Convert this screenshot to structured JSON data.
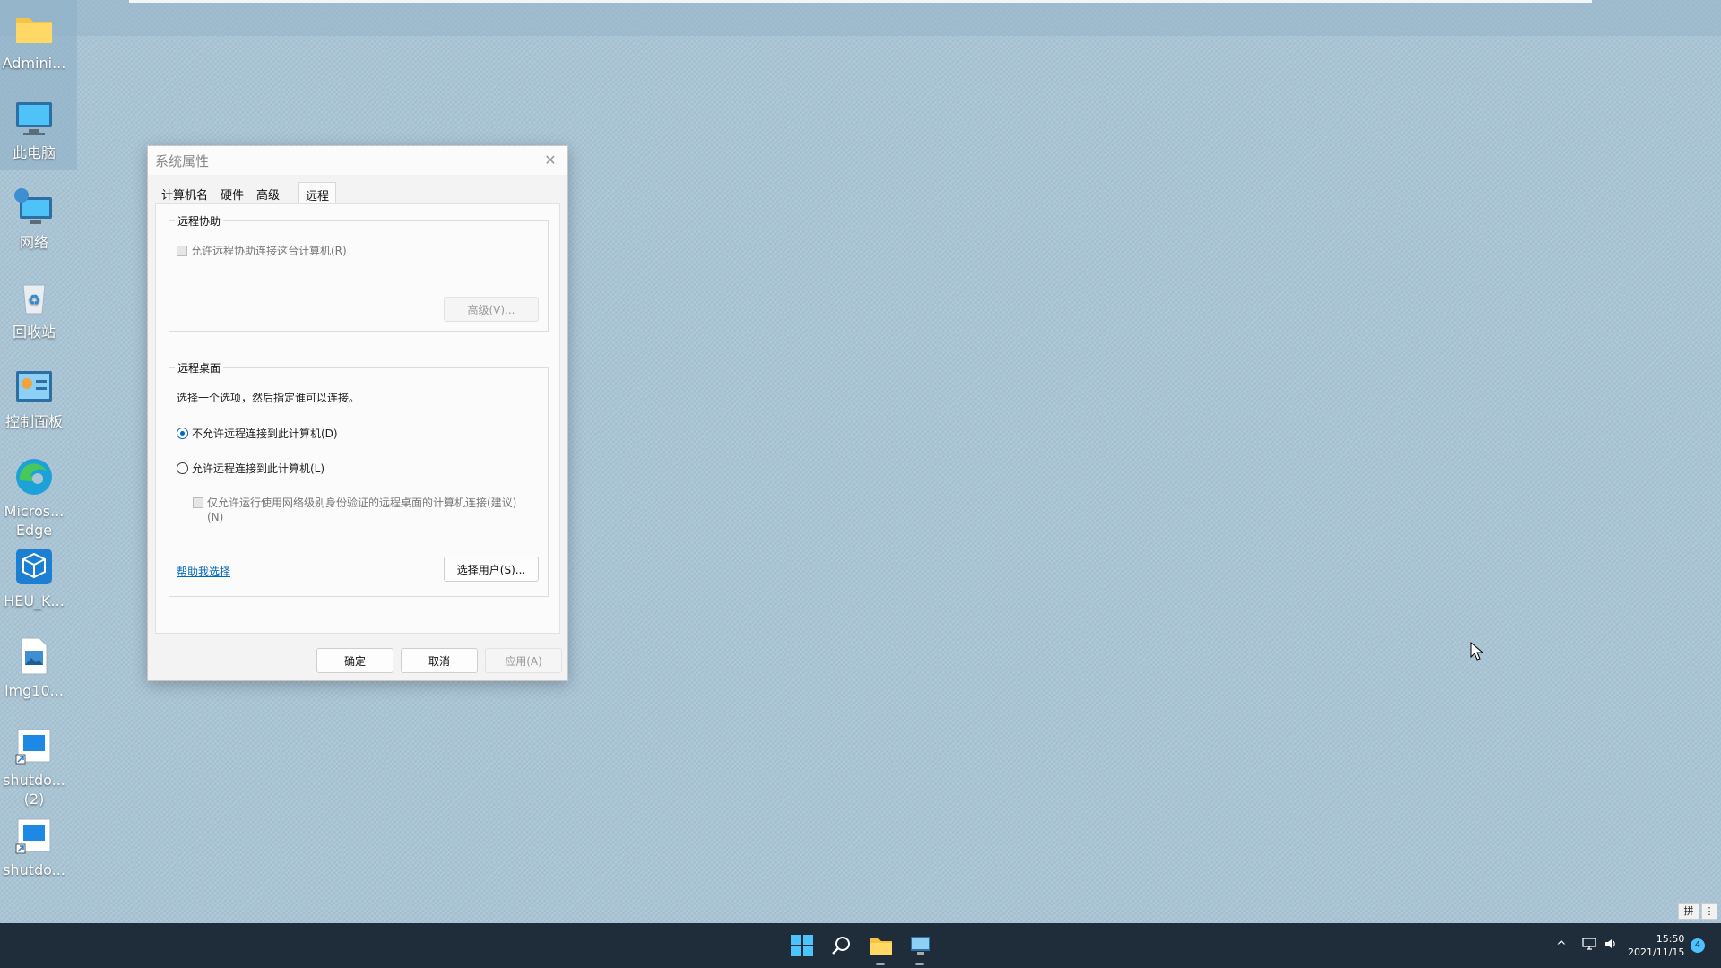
{
  "desktop": {
    "icons": [
      {
        "name": "folder-icon",
        "label": "Admini..."
      },
      {
        "name": "computer-icon",
        "label": "此电脑"
      },
      {
        "name": "network-icon",
        "label": "网络"
      },
      {
        "name": "recycle-bin-icon",
        "label": "回收站"
      },
      {
        "name": "control-panel-icon",
        "label": "控制面板"
      },
      {
        "name": "edge-icon",
        "label": "Micros... Edge"
      },
      {
        "name": "heu-kms-icon",
        "label": "HEU_K..."
      },
      {
        "name": "image-file-icon",
        "label": "img10..."
      },
      {
        "name": "shortcut-icon",
        "label": "shutdo... (2)"
      },
      {
        "name": "shortcut-icon",
        "label": "shutdo..."
      }
    ]
  },
  "dialog": {
    "title": "系统属性",
    "tabs": [
      "计算机名",
      "硬件",
      "高级",
      "远程"
    ],
    "active_tab": "远程",
    "remote_assistance": {
      "legend": "远程协助",
      "allow_label": "允许远程协助连接这台计算机(R)",
      "advanced_button": "高级(V)..."
    },
    "remote_desktop": {
      "legend": "远程桌面",
      "instruction": "选择一个选项，然后指定谁可以连接。",
      "option_deny": "不允许远程连接到此计算机(D)",
      "option_allow": "允许远程连接到此计算机(L)",
      "nla_line1": "仅允许运行使用网络级别身份验证的远程桌面的计算机连接(建议)",
      "nla_line2": "(N)",
      "help_link": "帮助我选择",
      "select_users_button": "选择用户(S)..."
    },
    "ok_button": "确定",
    "cancel_button": "取消",
    "apply_button": "应用(A)"
  },
  "taskbar": {
    "time": "15:50",
    "date": "2021/11/15",
    "notification_count": "4",
    "ime_label": "拼"
  },
  "colors": {
    "desktop_bg": "#a9c5d6",
    "taskbar_bg": "#1f2c3a",
    "accent": "#0067c0"
  }
}
